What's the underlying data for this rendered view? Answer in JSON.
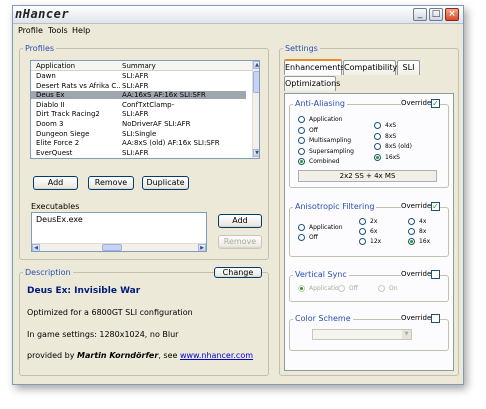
{
  "window": {
    "title": "nHancer",
    "controls": [
      "_",
      "□",
      "×"
    ]
  },
  "menu": {
    "items": [
      "Profile",
      "Tools",
      "Help"
    ]
  },
  "profiles": {
    "title": "Profiles",
    "columns": [
      "Application",
      "Summary"
    ],
    "rows": [
      {
        "app": "Dawn",
        "summary": "SLI:AFR"
      },
      {
        "app": "Desert Rats vs Afrika C...",
        "summary": "SLI:AFR"
      },
      {
        "app": "Deus Ex",
        "summary": "AA:16xS AF:16x SLI:SFR",
        "selected": true
      },
      {
        "app": "Diablo II",
        "summary": "ConfTxtClamp-"
      },
      {
        "app": "Dirt Track Racing2",
        "summary": "SLI:AFR"
      },
      {
        "app": "Doom 3",
        "summary": "NoDriverAF SLI:AFR"
      },
      {
        "app": "Dungeon Siege",
        "summary": "SLI:Single"
      },
      {
        "app": "Elite Force 2",
        "summary": "AA:8xS (old) AF:16x SLI:SFR"
      },
      {
        "app": "EverQuest",
        "summary": "SLI:AFR"
      }
    ],
    "buttons": {
      "add": "Add",
      "remove": "Remove",
      "duplicate": "Duplicate"
    }
  },
  "executables": {
    "label": "Executables",
    "items": [
      "DeusEx.exe"
    ],
    "buttons": {
      "add": "Add",
      "remove": "Remove"
    }
  },
  "description": {
    "title": "Description",
    "change_label": "Change",
    "game_title": "Deus Ex: Invisible War",
    "line1": "Optimized for a 6800GT SLI configuration",
    "line2": "In game settings: 1280x1024, no Blur",
    "provided_prefix": "provided by ",
    "author": "Martin Korndörfer",
    "see": ", see ",
    "link": "www.nhancer.com"
  },
  "settings": {
    "title": "Settings",
    "tabs": [
      "Enhancements",
      "Compatibility",
      "SLI",
      "Optimizations"
    ],
    "active_tab": "Enhancements",
    "override_label": "Override",
    "antialiasing": {
      "title": "Anti-Aliasing",
      "override": true,
      "col1": [
        "Application",
        "Off",
        "Multisampling",
        "Supersampling",
        "Combined"
      ],
      "col2": [
        "4xS",
        "8xS",
        "8xS (old)",
        "16xS"
      ],
      "selected_mode": "Combined",
      "selected_level": "16xS",
      "status": "2x2 SS + 4x MS"
    },
    "anisotropic": {
      "title": "Anisotropic Filtering",
      "override": true,
      "col1": [
        "Application",
        "Off"
      ],
      "col2": [
        "2x",
        "6x",
        "12x"
      ],
      "col3": [
        "4x",
        "8x",
        "16x"
      ],
      "selected": "16x"
    },
    "vsync": {
      "title": "Vertical Sync",
      "override": false,
      "options": [
        "Application",
        "Off",
        "On"
      ],
      "selected": "Application"
    },
    "colorscheme": {
      "title": "Color Scheme",
      "override": false
    }
  }
}
